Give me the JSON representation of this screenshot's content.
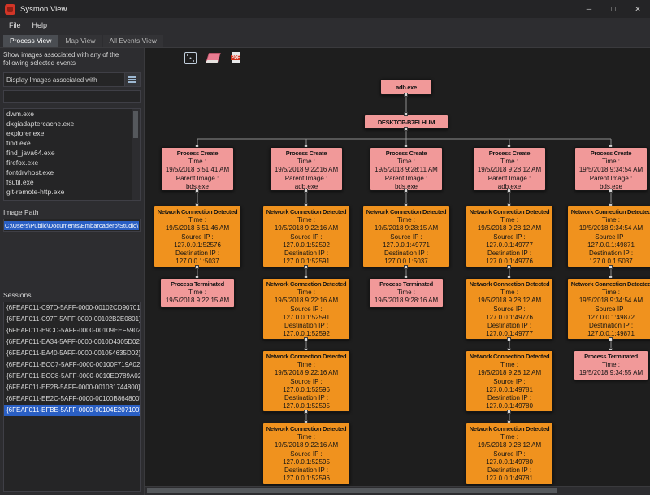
{
  "window": {
    "title": "Sysmon View",
    "buttons": {
      "minimize": "─",
      "maximize": "□",
      "close": "✕"
    }
  },
  "menu": {
    "items": [
      "File",
      "Help"
    ]
  },
  "tabs": [
    {
      "label": "Process View",
      "active": true
    },
    {
      "label": "Map View",
      "active": false
    },
    {
      "label": "All Events View",
      "active": false
    }
  ],
  "sidebar": {
    "filter_caption": "Show images associated with any of the following selected events",
    "display_combo_label": "Display Images associated with",
    "images": [
      "dwm.exe",
      "dxgiadaptercache.exe",
      "explorer.exe",
      "find.exe",
      "find_java64.exe",
      "firefox.exe",
      "fontdrvhost.exe",
      "fsutil.exe",
      "git-remote-http.exe"
    ],
    "image_path_label": "Image Path",
    "image_path_value": "C:\\Users\\Public\\Documents\\Embarcadero\\Studio\\",
    "sessions_label": "Sessions",
    "selected_session_index": 9,
    "sessions": [
      "{6FEAF011-C97D-5AFF-0000-00102CD90701}",
      "{6FEAF011-C97F-5AFF-0000-00102B2E0801}",
      "{6FEAF011-E9CD-5AFF-0000-00109EEF5902}",
      "{6FEAF011-EA34-5AFF-0000-0010D4305D02}",
      "{6FEAF011-EA40-5AFF-0000-001054635D02}",
      "{6FEAF011-ECC7-5AFF-0000-00100F719A02}",
      "{6FEAF011-ECC8-5AFF-0000-0010ED789A02}",
      "{6FEAF011-EE2B-5AFF-0000-001031744800}",
      "{6FEAF011-EE2C-5AFF-0000-00100B864800}",
      "{6FEAF011-EFBE-5AFF-0000-00104E207100}"
    ]
  },
  "toolbar": {
    "icons": [
      "dice-icon",
      "eraser-icon",
      "pdf-export-icon"
    ]
  },
  "colors": {
    "process_box": "#f19999",
    "network_box": "#f0921e",
    "selection": "#2a5fc4"
  },
  "diagram": {
    "root": "adb.exe",
    "host": "DESKTOP-B7ELHUM",
    "labels": {
      "time": "Time :",
      "parent_image": "Parent Image :",
      "source_ip": "Source IP :",
      "destination_ip": "Destination IP :"
    },
    "event_titles": {
      "create": "Process Create",
      "network": "Network Connection Detected",
      "terminated": "Process Terminated"
    },
    "columns": [
      {
        "events": [
          {
            "type": "create",
            "time": "19/5/2018 6:51:41 AM",
            "parent_image": "bds.exe"
          },
          {
            "type": "network",
            "time": "19/5/2018 6:51:46 AM",
            "source_ip": "127.0.0.1:52576",
            "destination_ip": "127.0.0.1:5037"
          },
          {
            "type": "terminated",
            "time": "19/5/2018 9:22:15 AM"
          }
        ]
      },
      {
        "events": [
          {
            "type": "create",
            "time": "19/5/2018 9:22:16 AM",
            "parent_image": "adb.exe"
          },
          {
            "type": "network",
            "time": "19/5/2018 9:22:16 AM",
            "source_ip": "127.0.0.1:52592",
            "destination_ip": "127.0.0.1:52591"
          },
          {
            "type": "network",
            "time": "19/5/2018 9:22:16 AM",
            "source_ip": "127.0.0.1:52591",
            "destination_ip": "127.0.0.1:52592"
          },
          {
            "type": "network",
            "time": "19/5/2018 9:22:16 AM",
            "source_ip": "127.0.0.1:52596",
            "destination_ip": "127.0.0.1:52595"
          },
          {
            "type": "network",
            "time": "19/5/2018 9:22:16 AM",
            "source_ip": "127.0.0.1:52595",
            "destination_ip": "127.0.0.1:52596"
          }
        ]
      },
      {
        "events": [
          {
            "type": "create",
            "time": "19/5/2018 9:28:11 AM",
            "parent_image": "bds.exe"
          },
          {
            "type": "network",
            "time": "19/5/2018 9:28:15 AM",
            "source_ip": "127.0.0.1:49771",
            "destination_ip": "127.0.0.1:5037"
          },
          {
            "type": "terminated",
            "time": "19/5/2018 9:28:16 AM"
          }
        ]
      },
      {
        "events": [
          {
            "type": "create",
            "time": "19/5/2018 9:28:12 AM",
            "parent_image": "adb.exe"
          },
          {
            "type": "network",
            "time": "19/5/2018 9:28:12 AM",
            "source_ip": "127.0.0.1:49777",
            "destination_ip": "127.0.0.1:49776"
          },
          {
            "type": "network",
            "time": "19/5/2018 9:28:12 AM",
            "source_ip": "127.0.0.1:49776",
            "destination_ip": "127.0.0.1:49777"
          },
          {
            "type": "network",
            "time": "19/5/2018 9:28:12 AM",
            "source_ip": "127.0.0.1:49781",
            "destination_ip": "127.0.0.1:49780"
          },
          {
            "type": "network",
            "time": "19/5/2018 9:28:12 AM",
            "source_ip": "127.0.0.1:49780",
            "destination_ip": "127.0.0.1:49781"
          }
        ]
      },
      {
        "events": [
          {
            "type": "create",
            "time": "19/5/2018 9:34:54 AM",
            "parent_image": "bds.exe"
          },
          {
            "type": "network",
            "time": "19/5/2018 9:34:54 AM",
            "source_ip": "127.0.0.1:49871",
            "destination_ip": "127.0.0.1:5037"
          },
          {
            "type": "network",
            "time": "19/5/2018 9:34:54 AM",
            "source_ip": "127.0.0.1:49872",
            "destination_ip": "127.0.0.1:49871"
          },
          {
            "type": "terminated",
            "time": "19/5/2018 9:34:55 AM"
          }
        ]
      }
    ]
  }
}
